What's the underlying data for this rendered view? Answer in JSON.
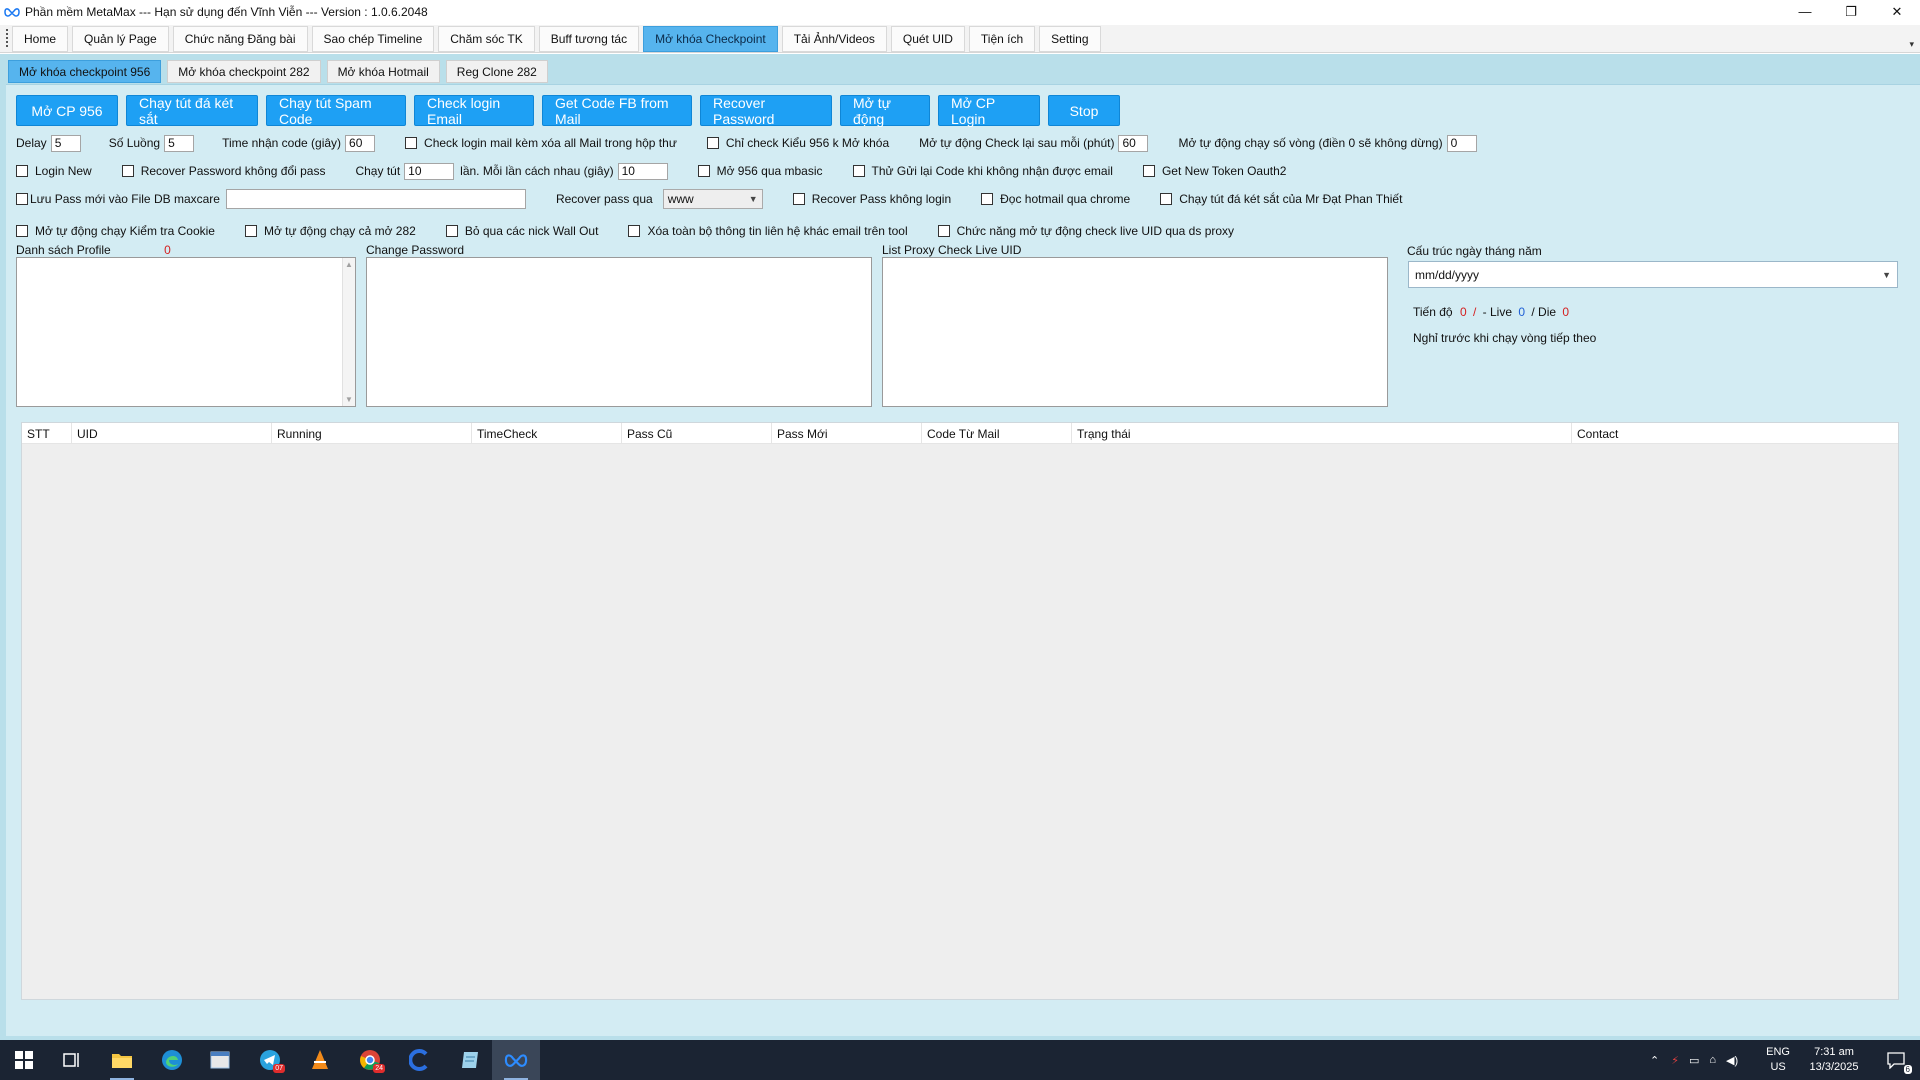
{
  "window": {
    "title": "Phần mềm MetaMax --- Hạn sử dụng đến Vĩnh Viễn --- Version : 1.0.6.2048",
    "minimize": "—",
    "maximize": "❐",
    "close": "✕"
  },
  "menu": {
    "tabs": [
      "Home",
      "Quản lý Page",
      "Chức năng Đăng bài",
      "Sao chép Timeline",
      "Chăm sóc TK",
      "Buff tương tác",
      "Mở khóa Checkpoint",
      "Tải Ảnh/Videos",
      "Quét UID",
      "Tiện ích",
      "Setting"
    ],
    "active_index": 6
  },
  "subtabs": {
    "tabs": [
      "Mở khóa checkpoint 956",
      "Mở khóa checkpoint 282",
      "Mở khóa Hotmail",
      "Reg Clone 282"
    ],
    "active_index": 0
  },
  "actions": [
    "Mở CP 956",
    "Chạy tút đá két sắt",
    "Chạy tút Spam Code",
    "Check login Email",
    "Get Code FB from Mail",
    "Recover Password",
    "Mở tự động",
    "Mở CP Login",
    "Stop"
  ],
  "options": {
    "delay_label": "Delay",
    "delay_value": "5",
    "threads_label": "Số Luồng",
    "threads_value": "5",
    "code_time_label": "Time nhận code (giây)",
    "code_time_value": "60",
    "check_login_mail_delete": "Check login mail kèm xóa all Mail trong hộp thư",
    "check_type_956": "Chỉ check Kiểu 956 k Mở khóa",
    "auto_recheck_label": "Mở tự động Check lại sau mỗi (phút)",
    "auto_recheck_value": "60",
    "auto_rounds_label": "Mở tự động chạy số vòng (điền 0 sẽ không dừng)",
    "auto_rounds_value": "0",
    "login_new": "Login New",
    "recover_no_change": "Recover Password không đổi pass",
    "run_tut_label": "Chạy tút",
    "run_tut_value": "10",
    "interval_label": "lần. Mỗi lần cách nhau (giây)",
    "interval_value": "10",
    "open_956_mbasic": "Mở 956 qua mbasic",
    "resend_code": "Thử Gửi lại Code khi không nhận được email",
    "new_token": "Get New Token Oauth2",
    "save_pass": "Lưu Pass mới vào File DB maxcare",
    "save_pass_path": "",
    "recover_via_label": "Recover pass qua",
    "recover_via_value": "www",
    "recover_no_login": "Recover Pass không login",
    "read_hotmail_chrome": "Đọc hotmail qua chrome",
    "run_tut_mr_dat": "Chạy tút đá két sắt của Mr Đạt Phan Thiết",
    "auto_check_cookie": "Mở tự động chạy Kiểm tra Cookie",
    "auto_run_282": "Mở tự động chạy cả mở 282",
    "skip_wall_out": "Bỏ qua các nick Wall Out",
    "delete_contacts": "Xóa toàn bộ thông tin liên hệ khác email trên tool",
    "auto_check_live_proxy": "Chức năng mở tự động check live UID qua ds proxy"
  },
  "lists": {
    "profiles_label": "Danh sách Profile",
    "profiles_count": "0",
    "change_password_label": "Change Password",
    "proxy_label": "List Proxy Check Live UID"
  },
  "right": {
    "date_format_label": "Cấu trúc ngày tháng năm",
    "date_format_value": "mm/dd/yyyy",
    "progress_label": "Tiến độ",
    "progress_value": "0",
    "progress_sep": "/",
    "live_label": "- Live",
    "live_value": "0",
    "die_label": "/ Die",
    "die_value": "0",
    "rest_label": "Nghỉ trước khi chạy vòng tiếp theo"
  },
  "grid": {
    "columns": [
      "STT",
      "UID",
      "Running",
      "TimeCheck",
      "Pass Cũ",
      "Pass Mới",
      "Code Từ Mail",
      "Trạng thái",
      "Contact"
    ]
  },
  "taskbar": {
    "telegram_badge": "07",
    "chrome_badge": "24",
    "lang_top": "ENG",
    "lang_bottom": "US",
    "time": "7:31 am",
    "date": "13/3/2025",
    "notifications": "6"
  },
  "colors": {
    "accent": "#1ea0f4",
    "active_tab": "#56b4ee",
    "panel_bg": "#d3ecf3",
    "taskbar": "#1b2433",
    "count_red": "#d42020",
    "count_blue": "#1e5fd6"
  }
}
